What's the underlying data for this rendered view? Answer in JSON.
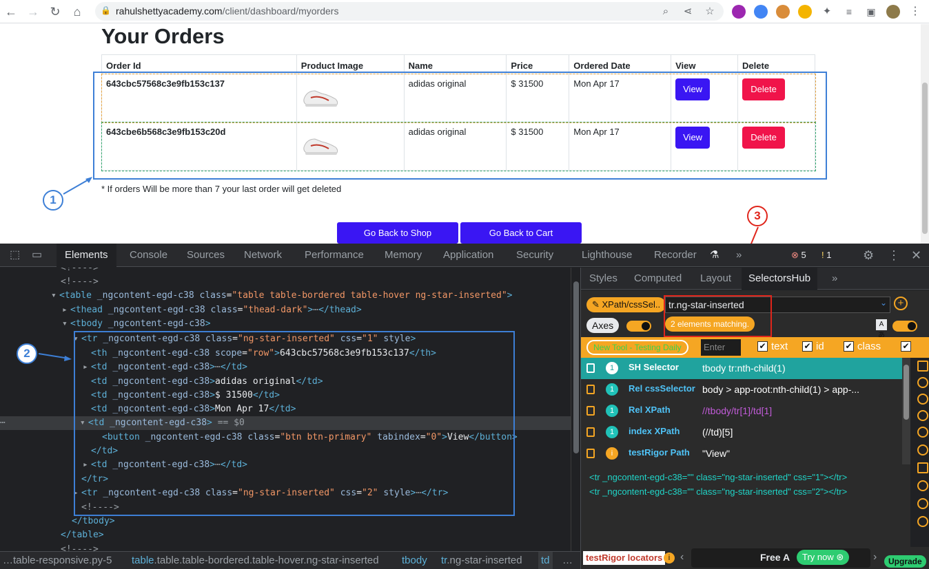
{
  "browser": {
    "url_host": "rahulshettyacademy.com",
    "url_path": "/client/dashboard/myorders"
  },
  "page": {
    "title": "Your Orders",
    "columns": [
      "Order Id",
      "Product Image",
      "Name",
      "Price",
      "Ordered Date",
      "View",
      "Delete"
    ],
    "rows": [
      {
        "id": "643cbc57568c3e9fb153c137",
        "name": "adidas original",
        "price": "$ 31500",
        "date": "Mon Apr 17",
        "view": "View",
        "delete": "Delete"
      },
      {
        "id": "643cbe6b568c3e9fb153c20d",
        "name": "adidas original",
        "price": "$ 31500",
        "date": "Mon Apr 17",
        "view": "View",
        "delete": "Delete"
      }
    ],
    "note": "* If orders Will be more than 7 your last order will get deleted",
    "go_shop": "Go Back to Shop",
    "go_cart": "Go Back to Cart"
  },
  "annotations": {
    "a1": "1",
    "a2": "2",
    "a3": "3"
  },
  "devtools": {
    "tabs": [
      "Elements",
      "Console",
      "Sources",
      "Network",
      "Performance",
      "Memory",
      "Application",
      "Security",
      "Lighthouse",
      "Recorder"
    ],
    "errors": "5",
    "warnings": "1",
    "breadcrumbs": [
      {
        "t": "",
        "c": "table-responsive.py-5"
      },
      {
        "t": "table",
        "c": ".table.table-bordered.table-hover.ng-star-inserted"
      },
      {
        "t": "tbody",
        "c": ""
      },
      {
        "t": "tr",
        "c": ".ng-star-inserted"
      },
      {
        "t": "td",
        "c": ""
      }
    ],
    "right_tabs": [
      "Styles",
      "Computed",
      "Layout",
      "SelectorsHub"
    ]
  },
  "selectorshub": {
    "mode_label": "XPath/cssSel..",
    "input_value": "tr.ng-star-inserted",
    "match_text": "2 elements matching.",
    "axes_label": "Axes",
    "promo_label": "New Tool - Testing Daily",
    "enter_placeholder": "Enter",
    "cb_text": "text",
    "cb_id": "id",
    "cb_class": "class",
    "rows": [
      {
        "count": "1",
        "name": "SH Selector",
        "value": "tbody tr:nth-child(1)"
      },
      {
        "count": "1",
        "name": "Rel cssSelector",
        "value": "body > app-root:nth-child(1) > app-..."
      },
      {
        "count": "1",
        "name": "Rel XPath",
        "value": "//tbody/tr[1]/td[1]"
      },
      {
        "count": "1",
        "name": "index XPath",
        "value": "(//td)[5]"
      },
      {
        "count": "i",
        "name": "testRigor Path",
        "value": "\"View\""
      }
    ],
    "matches": [
      "<tr _ngcontent-egd-c38=\"\" class=\"ng-star-inserted\" css=\"1\"></tr>",
      "<tr _ngcontent-egd-c38=\"\" class=\"ng-star-inserted\" css=\"2\"></tr>"
    ],
    "bottom": {
      "testrigor": "testRigor locators",
      "free": "Free A",
      "try": "Try now",
      "upgrade": "Upgrade"
    }
  },
  "colors": {
    "accent": "#3a16f3",
    "delete": "#f0144a",
    "annotation": "#3d7fd6",
    "highlight": "#e0251b",
    "sh_orange": "#f5a623",
    "sh_teal": "#20a39e"
  }
}
